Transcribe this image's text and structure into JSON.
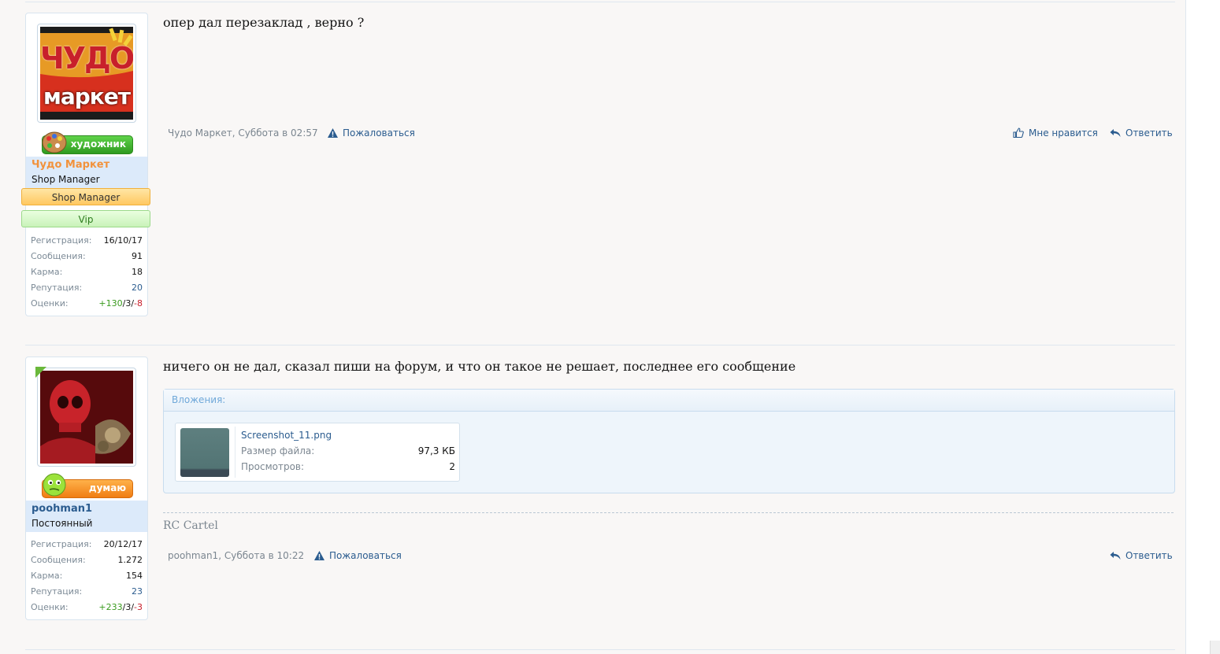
{
  "posts": [
    {
      "user": {
        "name": "Чудо Маркет",
        "name_color": "#f2923b",
        "title": "Shop Manager",
        "avatar_text_top": "ЧУДО",
        "avatar_text_bottom": "маркет",
        "trophy_label": "художник",
        "trophy_icon": "palette-icon",
        "banners": [
          {
            "label": "Shop Manager",
            "style": "orange"
          },
          {
            "label": "Vip",
            "style": "green"
          }
        ],
        "stats": [
          {
            "label": "Регистрация:",
            "value": "16/10/17"
          },
          {
            "label": "Сообщения:",
            "value": "91"
          },
          {
            "label": "Карма:",
            "value": "18"
          },
          {
            "label": "Репутация:",
            "value": "20"
          }
        ],
        "ratings_label": "Оценки:",
        "ratings": {
          "pos": "+130",
          "neu": "3",
          "neg": "-8"
        }
      },
      "message": "опер дал перезаклад , верно ?",
      "meta": {
        "author": "Чудо Маркет",
        "sep": ", ",
        "time": "Суббота в 02:57"
      },
      "report_label": "Пожаловаться",
      "like_label": "Мне нравится",
      "reply_label": "Ответить"
    },
    {
      "user": {
        "name": "poohman1",
        "name_color": "#2b5c8f",
        "title": "Постоянный",
        "trophy_label": "думаю",
        "trophy_icon": "smiley-icon",
        "stats": [
          {
            "label": "Регистрация:",
            "value": "20/12/17"
          },
          {
            "label": "Сообщения:",
            "value": "1.272"
          },
          {
            "label": "Карма:",
            "value": "154"
          },
          {
            "label": "Репутация:",
            "value": "23"
          }
        ],
        "ratings_label": "Оценки:",
        "ratings": {
          "pos": "+233",
          "neu": "3",
          "neg": "-3"
        }
      },
      "message": "ничего он не дал, сказал пиши на форум, и что он такое не решает, последнее его сообщение",
      "attachments_label": "Вложения:",
      "attachment": {
        "filename": "Screenshot_11.png",
        "size_label": "Размер файла:",
        "size_value": "97,3 КБ",
        "views_label": "Просмотров:",
        "views_value": "2"
      },
      "signature": "RC Cartel",
      "meta": {
        "author": "poohman1",
        "sep": ", ",
        "time": "Суббота в 10:22"
      },
      "report_label": "Пожаловаться",
      "reply_label": "Ответить"
    }
  ],
  "colors": {
    "link": "#2b5c8f",
    "positive": "#3a9b1e",
    "negative": "#c8202b",
    "accent_orange": "#f2923b"
  }
}
